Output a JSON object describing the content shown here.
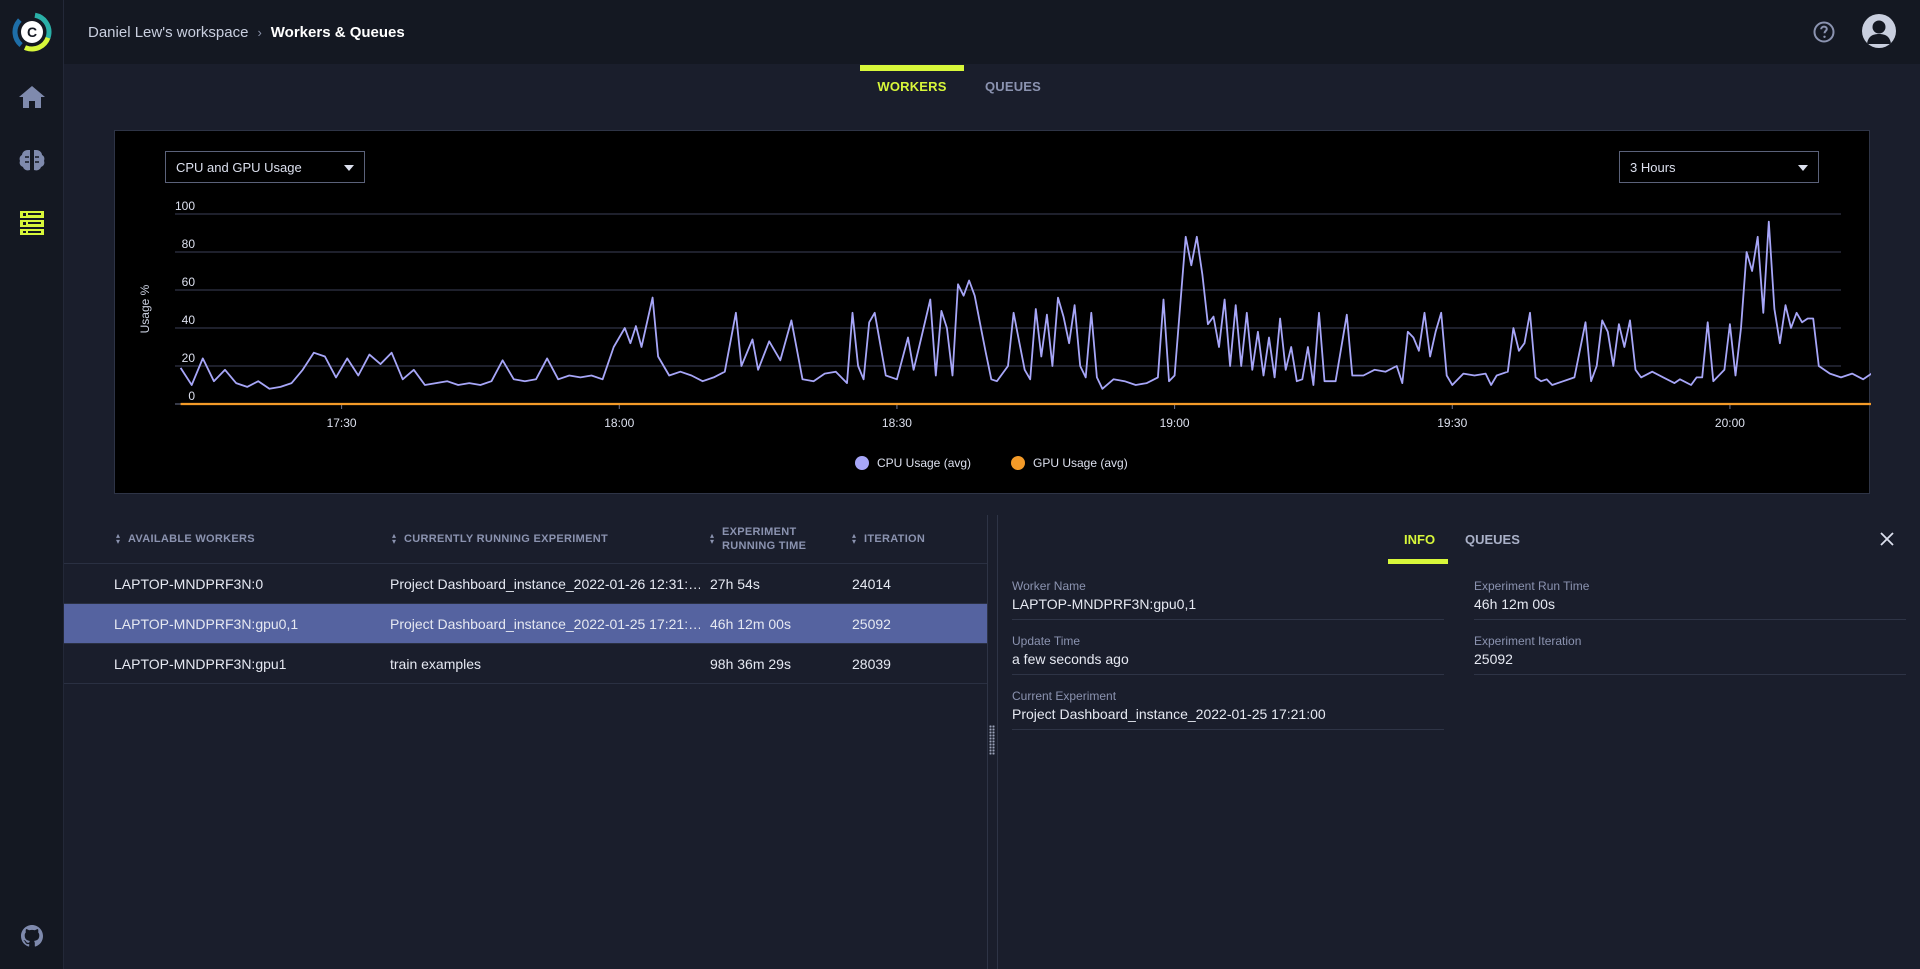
{
  "header": {
    "workspace": "Daniel Lew's workspace",
    "separator": "›",
    "page": "Workers & Queues"
  },
  "sidebar": {
    "items": [
      {
        "name": "home-icon"
      },
      {
        "name": "brain-icon"
      },
      {
        "name": "workers-icon"
      },
      {
        "name": "github-icon"
      }
    ]
  },
  "tabs": {
    "workers": "WORKERS",
    "queues": "QUEUES"
  },
  "chart_controls": {
    "metric_select": "CPU and GPU Usage",
    "range_select": "3 Hours"
  },
  "chart_data": {
    "type": "line",
    "title": "",
    "ylabel": "Usage %",
    "xlabel": "",
    "ylim": [
      0,
      100
    ],
    "yticks": [
      "0",
      "20",
      "40",
      "60",
      "80",
      "100"
    ],
    "xticks": [
      {
        "label": "17:30",
        "t": 17.5
      },
      {
        "label": "18:00",
        "t": 18.0
      },
      {
        "label": "18:30",
        "t": 18.5
      },
      {
        "label": "19:00",
        "t": 19.0
      },
      {
        "label": "19:30",
        "t": 19.5
      },
      {
        "label": "20:00",
        "t": 20.0
      }
    ],
    "x_unit": "hour of day",
    "xlim": [
      17.2,
      20.2
    ],
    "legend_position": "bottom-center",
    "series": [
      {
        "name": "CPU Usage (avg)",
        "color": "#a7a6f8",
        "points": [
          [
            17.21,
            19
          ],
          [
            17.23,
            10
          ],
          [
            17.25,
            24
          ],
          [
            17.27,
            12
          ],
          [
            17.29,
            18
          ],
          [
            17.31,
            11
          ],
          [
            17.33,
            9
          ],
          [
            17.35,
            12
          ],
          [
            17.37,
            8
          ],
          [
            17.39,
            9
          ],
          [
            17.41,
            11
          ],
          [
            17.43,
            18
          ],
          [
            17.45,
            27
          ],
          [
            17.47,
            25
          ],
          [
            17.49,
            14
          ],
          [
            17.51,
            24
          ],
          [
            17.53,
            15
          ],
          [
            17.55,
            26
          ],
          [
            17.57,
            21
          ],
          [
            17.59,
            27
          ],
          [
            17.61,
            13
          ],
          [
            17.63,
            18
          ],
          [
            17.65,
            10
          ],
          [
            17.67,
            11
          ],
          [
            17.69,
            12
          ],
          [
            17.71,
            10
          ],
          [
            17.73,
            11
          ],
          [
            17.75,
            10
          ],
          [
            17.77,
            12
          ],
          [
            17.79,
            23
          ],
          [
            17.81,
            13
          ],
          [
            17.83,
            12
          ],
          [
            17.85,
            13
          ],
          [
            17.87,
            24
          ],
          [
            17.89,
            13
          ],
          [
            17.91,
            15
          ],
          [
            17.93,
            14
          ],
          [
            17.95,
            15
          ],
          [
            17.97,
            13
          ],
          [
            17.99,
            30
          ],
          [
            18.01,
            40
          ],
          [
            18.02,
            32
          ],
          [
            18.03,
            41
          ],
          [
            18.04,
            30
          ],
          [
            18.06,
            56
          ],
          [
            18.07,
            25
          ],
          [
            18.09,
            15
          ],
          [
            18.11,
            17
          ],
          [
            18.13,
            15
          ],
          [
            18.15,
            12
          ],
          [
            18.17,
            14
          ],
          [
            18.19,
            17
          ],
          [
            18.21,
            48
          ],
          [
            18.22,
            20
          ],
          [
            18.24,
            34
          ],
          [
            18.25,
            18
          ],
          [
            18.27,
            33
          ],
          [
            18.29,
            23
          ],
          [
            18.31,
            44
          ],
          [
            18.33,
            13
          ],
          [
            18.35,
            12
          ],
          [
            18.37,
            16
          ],
          [
            18.39,
            17
          ],
          [
            18.41,
            11
          ],
          [
            18.42,
            48
          ],
          [
            18.43,
            20
          ],
          [
            18.44,
            13
          ],
          [
            18.45,
            43
          ],
          [
            18.46,
            48
          ],
          [
            18.48,
            15
          ],
          [
            18.5,
            13
          ],
          [
            18.52,
            35
          ],
          [
            18.53,
            18
          ],
          [
            18.54,
            30
          ],
          [
            18.56,
            55
          ],
          [
            18.57,
            15
          ],
          [
            18.58,
            49
          ],
          [
            18.59,
            40
          ],
          [
            18.6,
            15
          ],
          [
            18.61,
            63
          ],
          [
            18.62,
            57
          ],
          [
            18.63,
            65
          ],
          [
            18.64,
            57
          ],
          [
            18.65,
            42
          ],
          [
            18.66,
            27
          ],
          [
            18.67,
            13
          ],
          [
            18.68,
            12
          ],
          [
            18.7,
            20
          ],
          [
            18.71,
            48
          ],
          [
            18.72,
            33
          ],
          [
            18.73,
            18
          ],
          [
            18.74,
            13
          ],
          [
            18.75,
            50
          ],
          [
            18.76,
            25
          ],
          [
            18.77,
            47
          ],
          [
            18.78,
            20
          ],
          [
            18.79,
            56
          ],
          [
            18.8,
            46
          ],
          [
            18.81,
            32
          ],
          [
            18.82,
            52
          ],
          [
            18.83,
            20
          ],
          [
            18.84,
            14
          ],
          [
            18.85,
            48
          ],
          [
            18.86,
            14
          ],
          [
            18.87,
            8
          ],
          [
            18.89,
            13
          ],
          [
            18.91,
            12
          ],
          [
            18.93,
            10
          ],
          [
            18.95,
            11
          ],
          [
            18.97,
            14
          ],
          [
            18.98,
            55
          ],
          [
            18.99,
            12
          ],
          [
            19.0,
            15
          ],
          [
            19.02,
            88
          ],
          [
            19.03,
            73
          ],
          [
            19.04,
            88
          ],
          [
            19.05,
            68
          ],
          [
            19.06,
            42
          ],
          [
            19.07,
            46
          ],
          [
            19.08,
            30
          ],
          [
            19.09,
            55
          ],
          [
            19.1,
            20
          ],
          [
            19.11,
            52
          ],
          [
            19.12,
            20
          ],
          [
            19.13,
            48
          ],
          [
            19.14,
            18
          ],
          [
            19.15,
            38
          ],
          [
            19.16,
            15
          ],
          [
            19.17,
            35
          ],
          [
            19.18,
            14
          ],
          [
            19.19,
            45
          ],
          [
            19.2,
            18
          ],
          [
            19.21,
            30
          ],
          [
            19.22,
            12
          ],
          [
            19.23,
            13
          ],
          [
            19.24,
            30
          ],
          [
            19.25,
            10
          ],
          [
            19.26,
            48
          ],
          [
            19.27,
            12
          ],
          [
            19.29,
            12
          ],
          [
            19.31,
            47
          ],
          [
            19.32,
            15
          ],
          [
            19.34,
            15
          ],
          [
            19.36,
            18
          ],
          [
            19.38,
            17
          ],
          [
            19.4,
            20
          ],
          [
            19.41,
            11
          ],
          [
            19.42,
            38
          ],
          [
            19.43,
            35
          ],
          [
            19.44,
            28
          ],
          [
            19.45,
            48
          ],
          [
            19.46,
            25
          ],
          [
            19.47,
            38
          ],
          [
            19.48,
            48
          ],
          [
            19.49,
            15
          ],
          [
            19.5,
            10
          ],
          [
            19.52,
            16
          ],
          [
            19.54,
            15
          ],
          [
            19.56,
            16
          ],
          [
            19.57,
            10
          ],
          [
            19.58,
            15
          ],
          [
            19.6,
            17
          ],
          [
            19.61,
            40
          ],
          [
            19.62,
            28
          ],
          [
            19.63,
            32
          ],
          [
            19.64,
            48
          ],
          [
            19.65,
            14
          ],
          [
            19.66,
            12
          ],
          [
            19.67,
            13
          ],
          [
            19.68,
            10
          ],
          [
            19.7,
            12
          ],
          [
            19.72,
            14
          ],
          [
            19.74,
            43
          ],
          [
            19.75,
            12
          ],
          [
            19.76,
            20
          ],
          [
            19.77,
            44
          ],
          [
            19.78,
            38
          ],
          [
            19.79,
            20
          ],
          [
            19.8,
            42
          ],
          [
            19.81,
            30
          ],
          [
            19.82,
            44
          ],
          [
            19.83,
            18
          ],
          [
            19.84,
            14
          ],
          [
            19.86,
            17
          ],
          [
            19.88,
            14
          ],
          [
            19.9,
            11
          ],
          [
            19.91,
            13
          ],
          [
            19.93,
            10
          ],
          [
            19.94,
            14
          ],
          [
            19.95,
            14
          ],
          [
            19.96,
            43
          ],
          [
            19.97,
            12
          ],
          [
            19.99,
            18
          ],
          [
            20.0,
            42
          ],
          [
            20.01,
            15
          ],
          [
            20.02,
            40
          ],
          [
            20.03,
            80
          ],
          [
            20.04,
            70
          ],
          [
            20.05,
            88
          ],
          [
            20.06,
            48
          ],
          [
            20.07,
            96
          ],
          [
            20.08,
            50
          ],
          [
            20.09,
            32
          ],
          [
            20.1,
            52
          ],
          [
            20.11,
            40
          ],
          [
            20.12,
            48
          ],
          [
            20.13,
            43
          ],
          [
            20.14,
            45
          ],
          [
            20.15,
            45
          ],
          [
            20.16,
            20
          ],
          [
            20.18,
            16
          ],
          [
            20.2,
            14
          ],
          [
            20.22,
            16
          ],
          [
            20.24,
            13
          ],
          [
            20.26,
            17
          ],
          [
            20.28,
            12
          ],
          [
            20.3,
            13
          ],
          [
            20.32,
            18
          ],
          [
            20.34,
            14
          ],
          [
            20.36,
            15
          ],
          [
            20.38,
            13
          ],
          [
            20.4,
            12
          ],
          [
            20.41,
            16
          ],
          [
            20.43,
            14
          ],
          [
            20.45,
            15
          ],
          [
            20.47,
            14
          ],
          [
            20.49,
            15
          ],
          [
            20.51,
            14
          ],
          [
            20.53,
            15
          ],
          [
            20.55,
            14
          ]
        ]
      },
      {
        "name": "GPU Usage (avg)",
        "color": "#f39a28",
        "points": [
          [
            17.21,
            0
          ],
          [
            20.55,
            0
          ]
        ]
      }
    ]
  },
  "workers_table": {
    "columns": [
      "AVAILABLE WORKERS",
      "CURRENTLY RUNNING EXPERIMENT",
      "EXPERIMENT",
      "RUNNING TIME",
      "ITERATION"
    ],
    "rows": [
      {
        "worker": "LAPTOP-MNDPRF3N:0",
        "experiment": "Project Dashboard_instance_2022-01-26 12:31:…",
        "time": "27h 54s",
        "iteration": "24014",
        "selected": false
      },
      {
        "worker": "LAPTOP-MNDPRF3N:gpu0,1",
        "experiment": "Project Dashboard_instance_2022-01-25 17:21:…",
        "time": "46h 12m 00s",
        "iteration": "25092",
        "selected": true
      },
      {
        "worker": "LAPTOP-MNDPRF3N:gpu1",
        "experiment": "train examples",
        "time": "98h 36m 29s",
        "iteration": "28039",
        "selected": false
      }
    ]
  },
  "details": {
    "tabs": {
      "info": "INFO",
      "queues": "QUEUES"
    },
    "fields": {
      "worker_name_label": "Worker Name",
      "worker_name": "LAPTOP-MNDPRF3N:gpu0,1",
      "update_time_label": "Update Time",
      "update_time": "a few seconds ago",
      "current_experiment_label": "Current Experiment",
      "current_experiment": "Project Dashboard_instance_2022-01-25 17:21:00",
      "run_time_label": "Experiment Run Time",
      "run_time": "46h 12m 00s",
      "iteration_label": "Experiment Iteration",
      "iteration": "25092"
    }
  },
  "colors": {
    "accent": "#d8f73a",
    "selected_row": "#5563a0",
    "cpu": "#a7a6f8",
    "gpu": "#f39a28"
  }
}
